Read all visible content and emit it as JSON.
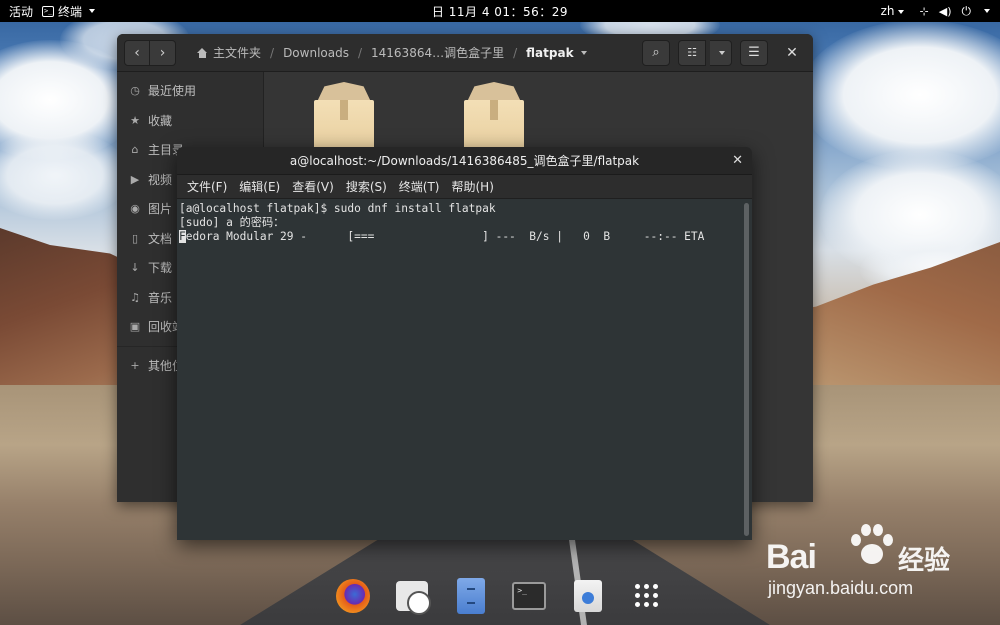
{
  "topbar": {
    "activities": "活动",
    "app_name": "终端",
    "clock": "日 11月 4  01：56：29",
    "lang": "zh"
  },
  "files": {
    "breadcrumbs": [
      "主文件夹",
      "Downloads",
      "14163864…调色盒子里",
      "flatpak"
    ],
    "sidebar": [
      {
        "icon": "clock-icon",
        "glyph": "◷",
        "label": "最近使用"
      },
      {
        "icon": "star-icon",
        "glyph": "★",
        "label": "收藏"
      },
      {
        "icon": "home-icon",
        "glyph": "⌂",
        "label": "主目录"
      },
      {
        "icon": "video-icon",
        "glyph": "▶",
        "label": "视频"
      },
      {
        "icon": "camera-icon",
        "glyph": "◉",
        "label": "图片"
      },
      {
        "icon": "document-icon",
        "glyph": "▯",
        "label": "文档"
      },
      {
        "icon": "download-icon",
        "glyph": "↓",
        "label": "下载"
      },
      {
        "icon": "music-icon",
        "glyph": "♫",
        "label": "音乐"
      },
      {
        "icon": "trash-icon",
        "glyph": "▣",
        "label": "回收站"
      },
      {
        "icon": "plus-icon",
        "glyph": "+",
        "label": "其他位置"
      }
    ]
  },
  "terminal": {
    "title": "a@localhost:~/Downloads/1416386485_调色盒子里/flatpak",
    "menu": [
      "文件(F)",
      "编辑(E)",
      "查看(V)",
      "搜索(S)",
      "终端(T)",
      "帮助(H)"
    ],
    "lines": [
      "[a@localhost flatpak]$ sudo dnf install flatpak",
      "[sudo] a 的密码：",
      "edora Modular 29 -      [===                ] ---  B/s |   0  B     --:-- ETA"
    ],
    "cursor_char": "F"
  },
  "dock": {
    "apps": [
      "firefox-icon",
      "clock-app-icon",
      "files-app-icon",
      "terminal-app-icon",
      "software-app-icon",
      "app-grid-icon"
    ],
    "terminal_glyph": ">_"
  },
  "watermark": {
    "brand": "Bai",
    "suffix": "经验",
    "url": "jingyan.baidu.com"
  }
}
